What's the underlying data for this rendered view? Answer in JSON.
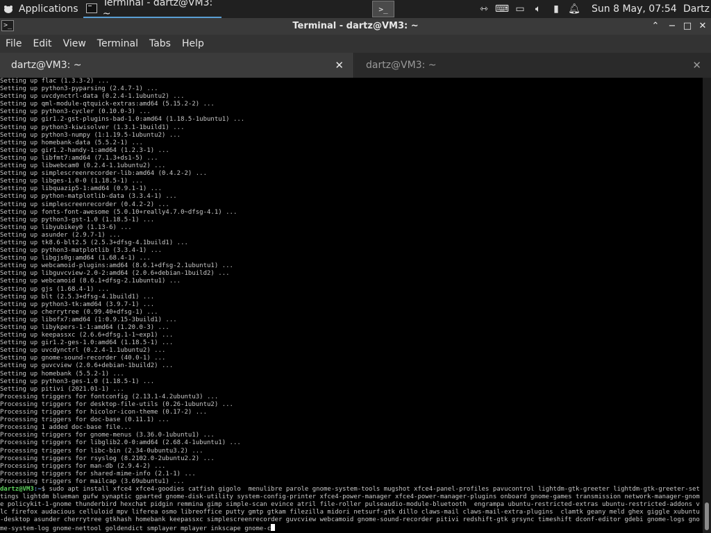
{
  "panel": {
    "applications_label": "Applications",
    "task_label": "Terminal - dartz@VM3: ~",
    "launcher_label": ">_",
    "tray_icons": [
      "network-icon",
      "keyboard-icon",
      "display-icon",
      "volume-icon",
      "battery-icon",
      "notification-bell-icon"
    ],
    "clock": "Sun  8 May, 07:54",
    "user": "Dartz"
  },
  "window": {
    "title": "Terminal - dartz@VM3: ~",
    "icon_label": ">_",
    "buttons": {
      "up": "⌃",
      "minimize": "−",
      "maximize": "□",
      "close": "✕"
    }
  },
  "menu": [
    "File",
    "Edit",
    "View",
    "Terminal",
    "Tabs",
    "Help"
  ],
  "tabs": [
    {
      "label": "dartz@VM3: ~",
      "active": true
    },
    {
      "label": "dartz@VM3: ~",
      "active": false
    }
  ],
  "terminal": {
    "lines": [
      "Setting up flac (1.3.3-2) ...",
      "Setting up python3-pyparsing (2.4.7-1) ...",
      "Setting up uvcdynctrl-data (0.2.4-1.1ubuntu2) ...",
      "Setting up qml-module-qtquick-extras:amd64 (5.15.2-2) ...",
      "Setting up python3-cycler (0.10.0-3) ...",
      "Setting up gir1.2-gst-plugins-bad-1.0:amd64 (1.18.5-1ubuntu1) ...",
      "Setting up python3-kiwisolver (1.3.1-1build1) ...",
      "Setting up python3-numpy (1:1.19.5-1ubuntu2) ...",
      "Setting up homebank-data (5.5.2-1) ...",
      "Setting up gir1.2-handy-1:amd64 (1.2.3-1) ...",
      "Setting up libfmt7:amd64 (7.1.3+ds1-5) ...",
      "Setting up libwebcam0 (0.2.4-1.1ubuntu2) ...",
      "Setting up simplescreenrecorder-lib:amd64 (0.4.2-2) ...",
      "Setting up libges-1.0-0 (1.18.5-1) ...",
      "Setting up libquazip5-1:amd64 (0.9.1-1) ...",
      "Setting up python-matplotlib-data (3.3.4-1) ...",
      "Setting up simplescreenrecorder (0.4.2-2) ...",
      "Setting up fonts-font-awesome (5.0.10+really4.7.0~dfsg-4.1) ...",
      "Setting up python3-gst-1.0 (1.18.5-1) ...",
      "Setting up libyubikey0 (1.13-6) ...",
      "Setting up asunder (2.9.7-1) ...",
      "Setting up tk8.6-blt2.5 (2.5.3+dfsg-4.1build1) ...",
      "Setting up python3-matplotlib (3.3.4-1) ...",
      "Setting up libgjs0g:amd64 (1.68.4-1) ...",
      "Setting up webcamoid-plugins:amd64 (8.6.1+dfsg-2.1ubuntu1) ...",
      "Setting up libguvcview-2.0-2:amd64 (2.0.6+debian-1build2) ...",
      "Setting up webcamoid (8.6.1+dfsg-2.1ubuntu1) ...",
      "Setting up gjs (1.68.4-1) ...",
      "Setting up blt (2.5.3+dfsg-4.1build1) ...",
      "Setting up python3-tk:amd64 (3.9.7-1) ...",
      "Setting up cherrytree (0.99.40+dfsg-1) ...",
      "Setting up libofx7:amd64 (1:0.9.15-3build1) ...",
      "Setting up libykpers-1-1:amd64 (1.20.0-3) ...",
      "Setting up keepassxc (2.6.6+dfsg.1-1~exp1) ...",
      "Setting up gir1.2-ges-1.0:amd64 (1.18.5-1) ...",
      "Setting up uvcdynctrl (0.2.4-1.1ubuntu2) ...",
      "Setting up gnome-sound-recorder (40.0-1) ...",
      "Setting up guvcview (2.0.6+debian-1build2) ...",
      "Setting up homebank (5.5.2-1) ...",
      "Setting up python3-ges-1.0 (1.18.5-1) ...",
      "Setting up pitivi (2021.01-1) ...",
      "Processing triggers for fontconfig (2.13.1-4.2ubuntu3) ...",
      "Processing triggers for desktop-file-utils (0.26-1ubuntu2) ...",
      "Processing triggers for hicolor-icon-theme (0.17-2) ...",
      "Processing triggers for doc-base (0.11.1) ...",
      "Processing 1 added doc-base file...",
      "Processing triggers for gnome-menus (3.36.0-1ubuntu1) ...",
      "Processing triggers for libglib2.0-0:amd64 (2.68.4-1ubuntu1) ...",
      "Processing triggers for libc-bin (2.34-0ubuntu3.2) ...",
      "Processing triggers for rsyslog (8.2102.0-2ubuntu2.2) ...",
      "Processing triggers for man-db (2.9.4-2) ...",
      "Processing triggers for shared-mime-info (2.1-1) ...",
      "Processing triggers for mailcap (3.69ubuntu1) ..."
    ],
    "prompt_user": "dartz@VM3",
    "prompt_path": ":~",
    "prompt_symbol": "$ ",
    "command": "sudo apt install xfce4 xfce4-goodies catfish gigolo  menulibre parole gnome-system-tools mugshot xfce4-panel-profiles pavucontrol lightdm-gtk-greeter lightdm-gtk-greeter-settings lightdm blueman gufw synaptic gparted gnome-disk-utility system-config-printer xfce4-power-manager xfce4-power-manager-plugins onboard gnome-games transmission network-manager-gnome policykit-1-gnome thunderbird hexchat pidgin remmina gimp simple-scan evince atril file-roller pulseaudio-module-bluetooth  engrampa ubuntu-restricted-extras ubuntu-restricted-addons vlc firefox audacious celluloid mpv liferea osmo libreoffice putty gmtp gtkam filezilla midori netsurf-gtk dillo claws-mail claws-mail-extra-plugins  clamtk geany meld ghex giggle xubuntu-desktop asunder cherrytree gtkhash homebank keepassxc simplescreenrecorder guvcview webcamoid gnome-sound-recorder pitivi redshift-gtk grsync timeshift dconf-editor gdebi gnome-logs gnome-system-log gnome-nettool goldendict smplayer mplayer inkscape gnome-c"
  }
}
